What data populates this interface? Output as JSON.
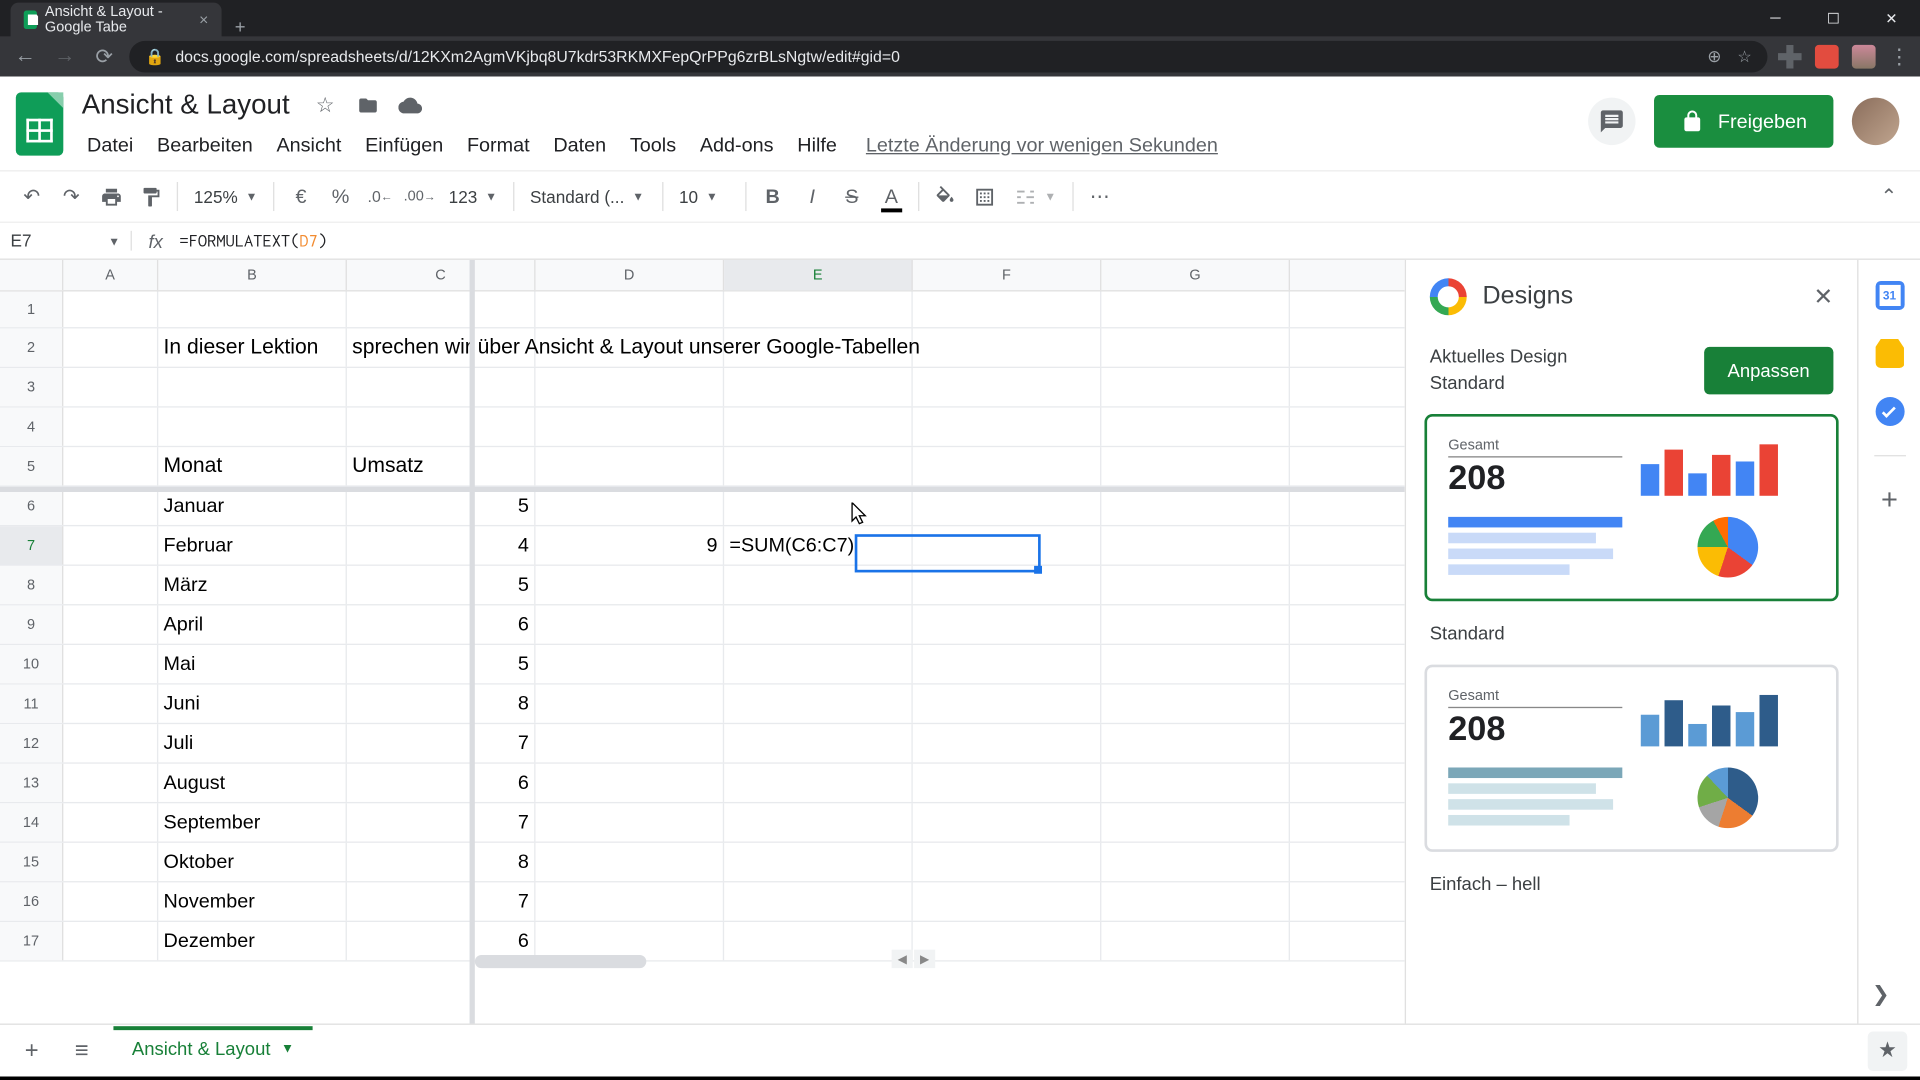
{
  "browser": {
    "tab_title": "Ansicht & Layout - Google Tabe",
    "url": "docs.google.com/spreadsheets/d/12KXm2AgmVKjbq8U7kdr53RKMXFepQrPPg6zrBLsNgtw/edit#gid=0"
  },
  "doc": {
    "title": "Ansicht & Layout",
    "menu": [
      "Datei",
      "Bearbeiten",
      "Ansicht",
      "Einfügen",
      "Format",
      "Daten",
      "Tools",
      "Add-ons",
      "Hilfe"
    ],
    "last_edit": "Letzte Änderung vor wenigen Sekunden",
    "share": "Freigeben"
  },
  "toolbar": {
    "zoom": "125%",
    "currency": "€",
    "percent": "%",
    "dec_dec": ".0",
    "dec_inc": ".00",
    "format_num": "123",
    "font": "Standard (...",
    "font_size": "10"
  },
  "formula": {
    "name_box": "E7",
    "prefix": "=FORMULATEXT(",
    "ref": "D7",
    "suffix": ")"
  },
  "columns": [
    "A",
    "B",
    "C",
    "D",
    "E",
    "F",
    "G"
  ],
  "rows": [
    {
      "n": 1
    },
    {
      "n": 2,
      "B": "In dieser Lektion",
      "C": "sprechen wir über Ansicht & Layout unserer Google-Tabellen"
    },
    {
      "n": 3
    },
    {
      "n": 4
    },
    {
      "n": 5,
      "B": "Monat",
      "C": "Umsatz"
    },
    {
      "n": 6,
      "B": "Januar",
      "C": "5"
    },
    {
      "n": 7,
      "B": "Februar",
      "C": "4",
      "D": "9",
      "E": "=SUM(C6:C7)"
    },
    {
      "n": 8,
      "B": "März",
      "C": "5"
    },
    {
      "n": 9,
      "B": "April",
      "C": "6"
    },
    {
      "n": 10,
      "B": "Mai",
      "C": "5"
    },
    {
      "n": 11,
      "B": "Juni",
      "C": "8"
    },
    {
      "n": 12,
      "B": "Juli",
      "C": "7"
    },
    {
      "n": 13,
      "B": "August",
      "C": "6"
    },
    {
      "n": 14,
      "B": "September",
      "C": "7"
    },
    {
      "n": 15,
      "B": "Oktober",
      "C": "8"
    },
    {
      "n": 16,
      "B": "November",
      "C": "7"
    },
    {
      "n": 17,
      "B": "Dezember",
      "C": "6"
    }
  ],
  "selected": {
    "row": 7,
    "col": "E"
  },
  "side": {
    "title": "Designs",
    "current_label": "Aktuelles Design",
    "current_value": "Standard",
    "button": "Anpassen",
    "preview_label": "Gesamt",
    "preview_value": "208",
    "design1_name": "Standard",
    "design2_name": "Einfach – hell"
  },
  "sheet_tab": "Ansicht & Layout"
}
